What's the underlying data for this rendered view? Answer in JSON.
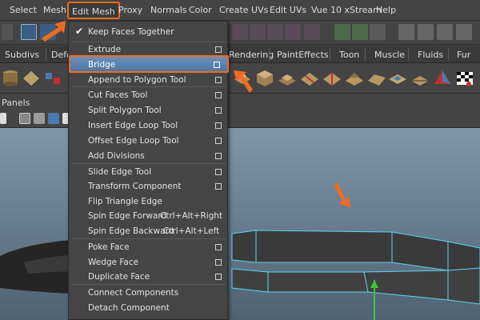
{
  "menubar": {
    "items": [
      "Select",
      "Mesh",
      "Edit Mesh",
      "Proxy",
      "Normals",
      "Color",
      "Create UVs",
      "Edit UVs",
      "Vue 10 xStream",
      "Help"
    ]
  },
  "shelf_tabs": [
    "Subdivs",
    "Defo",
    "Rendering",
    "PaintEffects",
    "Toon",
    "Muscle",
    "Fluids",
    "Fur"
  ],
  "panels_label": "Panels",
  "dropdown": {
    "items": [
      {
        "label": "Keep Faces Together",
        "checked": true
      },
      {
        "label": "Extrude",
        "option": true
      },
      {
        "label": "Bridge",
        "option": true,
        "highlighted": true
      },
      {
        "label": "Append to Polygon Tool",
        "option": true
      },
      {
        "label": "Cut Faces Tool",
        "option": true
      },
      {
        "label": "Split Polygon Tool",
        "option": true
      },
      {
        "label": "Insert Edge Loop Tool",
        "option": true
      },
      {
        "label": "Offset Edge Loop Tool",
        "option": true
      },
      {
        "label": "Add Divisions",
        "option": true
      },
      {
        "label": "Slide Edge Tool",
        "option": true
      },
      {
        "label": "Transform Component",
        "option": true
      },
      {
        "label": "Flip Triangle Edge"
      },
      {
        "label": "Spin Edge Forward",
        "shortcut": "Ctrl+Alt+Right"
      },
      {
        "label": "Spin Edge Backward",
        "shortcut": "Ctrl+Alt+Left"
      },
      {
        "label": "Poke Face",
        "option": true
      },
      {
        "label": "Wedge Face",
        "option": true
      },
      {
        "label": "Duplicate Face",
        "option": true
      },
      {
        "label": "Connect Components"
      },
      {
        "label": "Detach Component"
      }
    ]
  },
  "colors": {
    "accent_orange": "#f26a21",
    "highlight_blue": "#5b82b0",
    "mesh_outline": "#5fd4f0",
    "viewport_top": "#7f94a6"
  }
}
